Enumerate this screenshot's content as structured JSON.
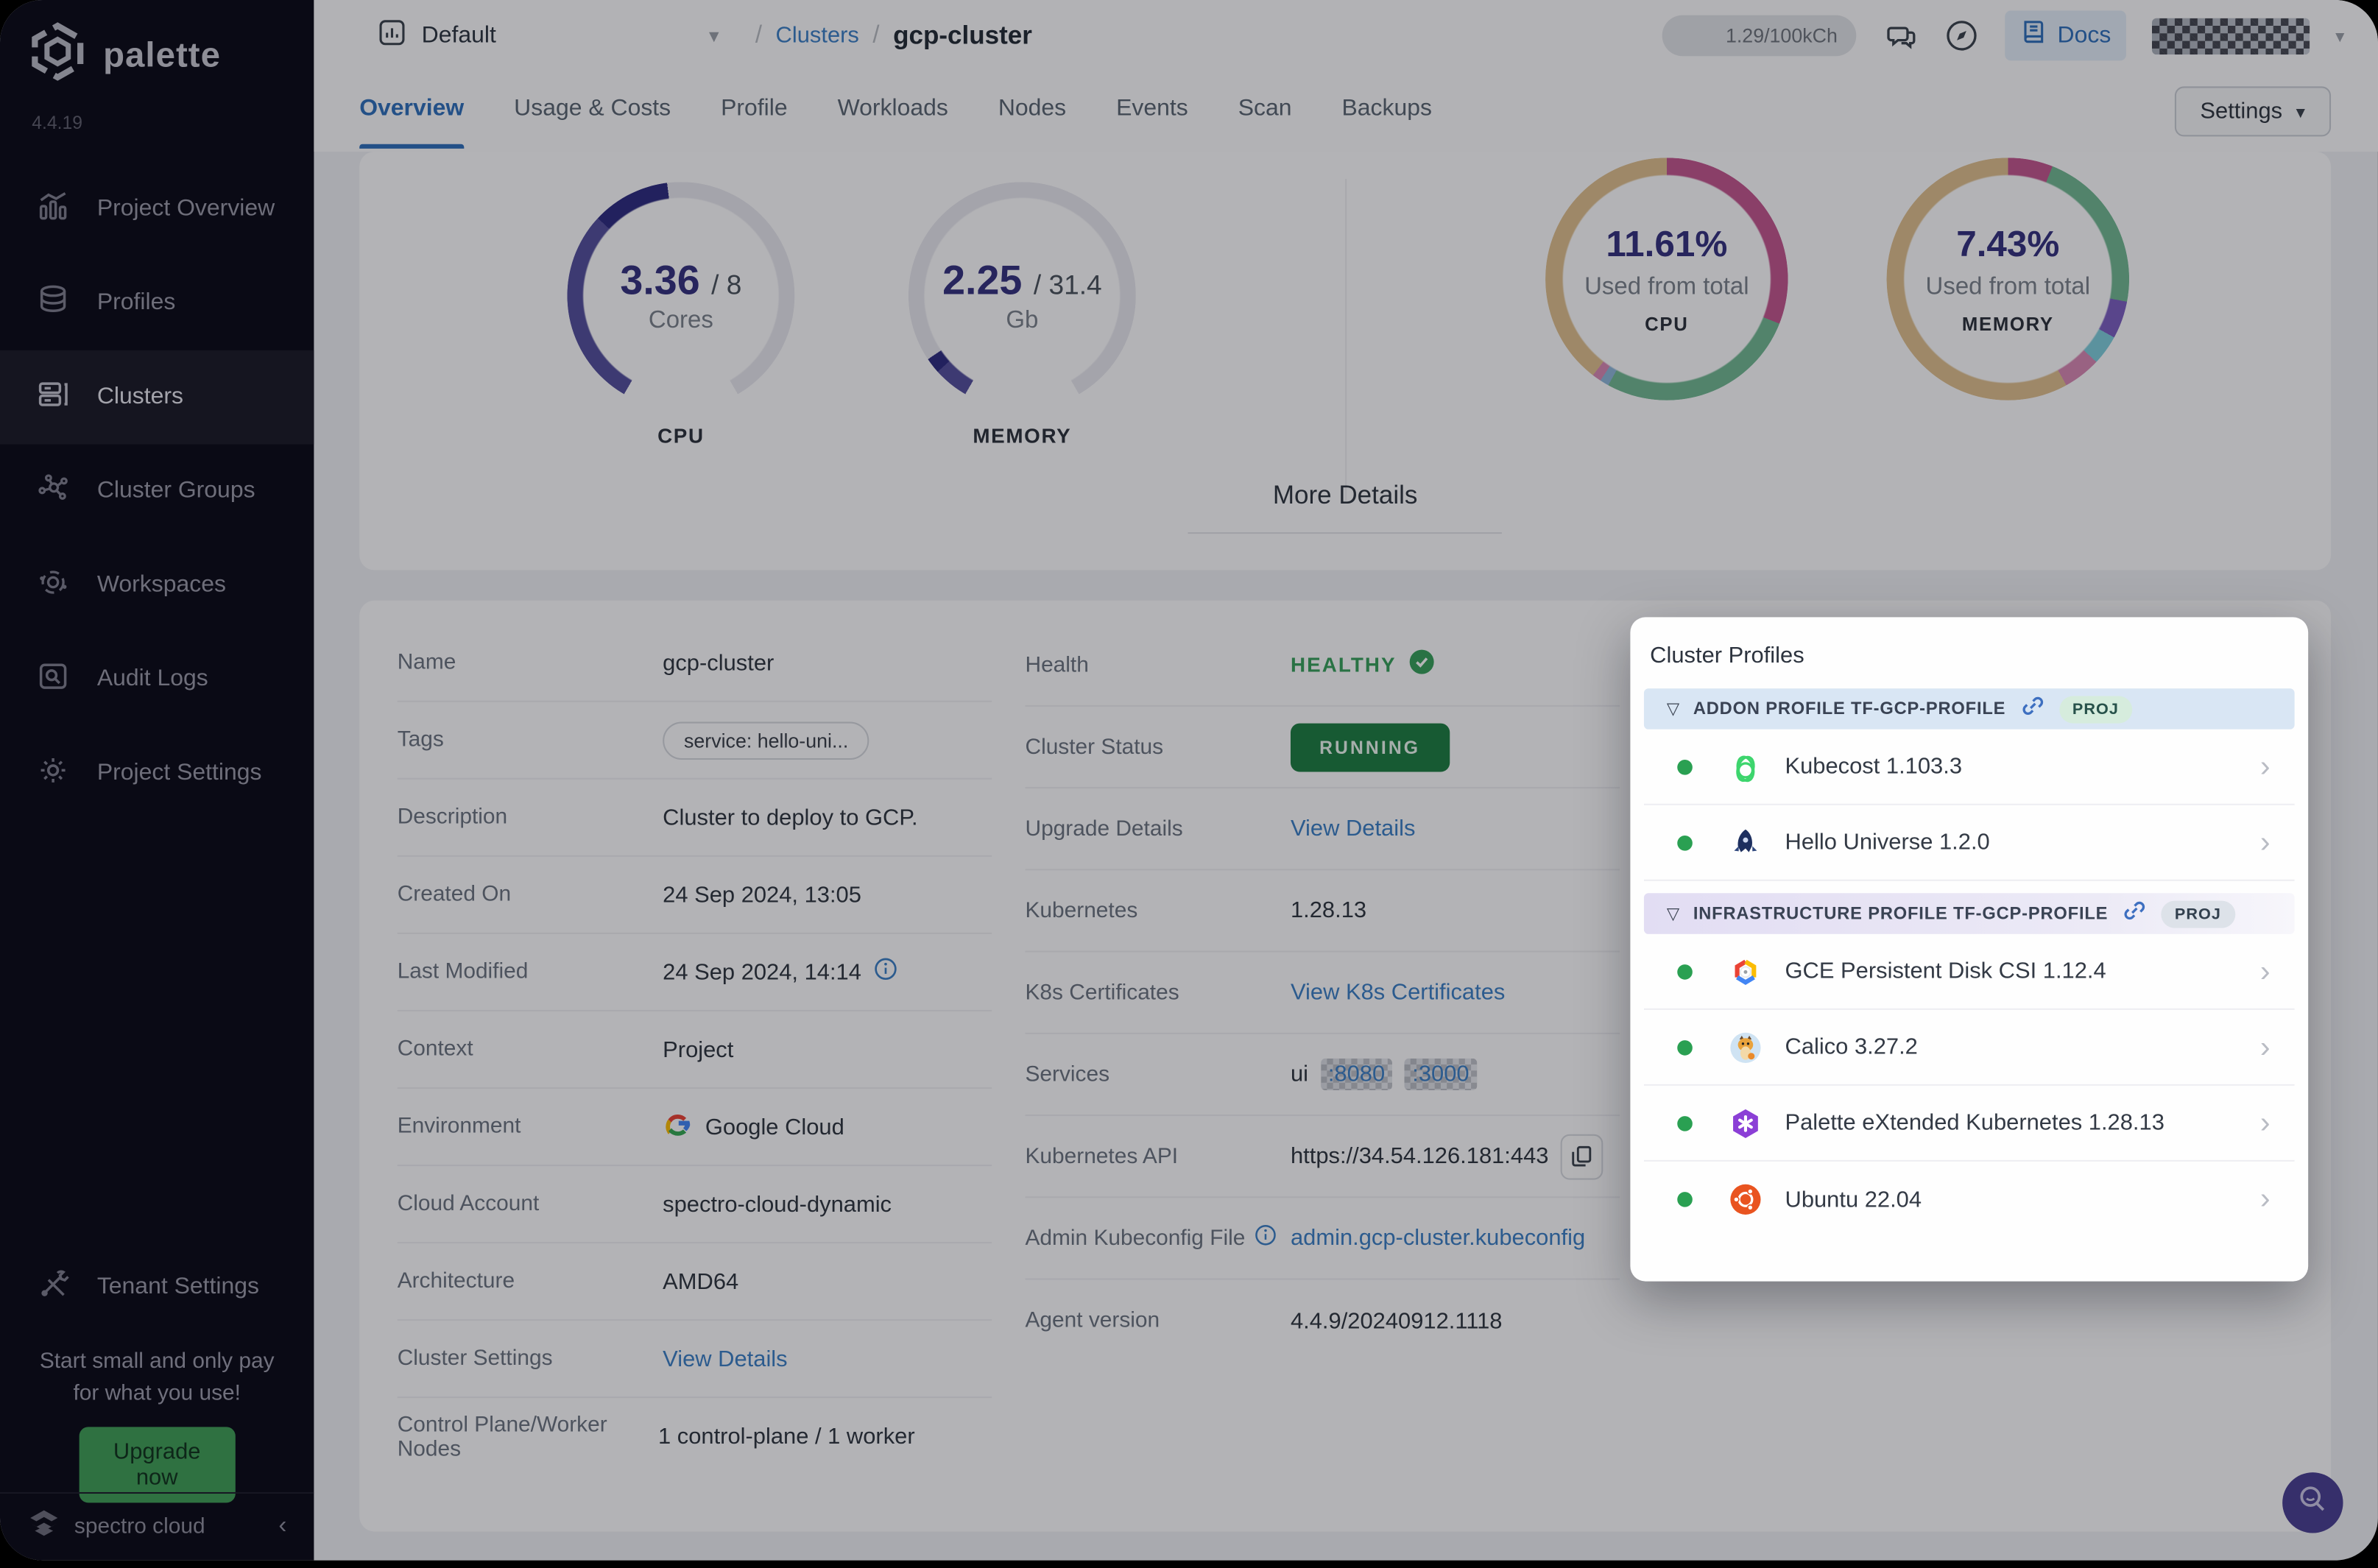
{
  "sidebar": {
    "logo_text": "palette",
    "version": "4.4.19",
    "items": [
      {
        "label": "Project Overview"
      },
      {
        "label": "Profiles"
      },
      {
        "label": "Clusters"
      },
      {
        "label": "Cluster Groups"
      },
      {
        "label": "Workspaces"
      },
      {
        "label": "Audit Logs"
      },
      {
        "label": "Project Settings"
      },
      {
        "label": "Tenant Settings"
      }
    ],
    "promo_line1": "Start small and only pay",
    "promo_line2": "for what you use!",
    "upgrade_label": "Upgrade now",
    "brand": "spectro cloud"
  },
  "topbar": {
    "project_selector": "Default",
    "breadcrumb_section": "Clusters",
    "breadcrumb_current": "gcp-cluster",
    "credits": "1.29/100kCh",
    "docs_label": "Docs"
  },
  "tabs": {
    "items": [
      "Overview",
      "Usage & Costs",
      "Profile",
      "Workloads",
      "Nodes",
      "Events",
      "Scan",
      "Backups"
    ],
    "settings_label": "Settings"
  },
  "stats": {
    "more_details_label": "More Details",
    "gauges": [
      {
        "metric": "CPU",
        "value": "3.36",
        "total": "/ 8",
        "unit": "Cores",
        "track_deg": 300,
        "segments": [
          {
            "color": "#54509c",
            "deg": 103
          },
          {
            "color": "#2d2b80",
            "deg": 40
          }
        ]
      },
      {
        "metric": "MEMORY",
        "value": "2.25",
        "total": "/ 31.4",
        "unit": "Gb",
        "track_deg": 300,
        "segments": [
          {
            "color": "#54509c",
            "deg": 18
          },
          {
            "color": "#2d2b80",
            "deg": 8
          }
        ]
      }
    ],
    "donuts": [
      {
        "metric": "CPU",
        "percent": "11.61%",
        "caption": "Used from total",
        "segments": [
          {
            "color": "#c2568f",
            "pct": 31
          },
          {
            "color": "#72b893",
            "pct": 27
          },
          {
            "color": "#8fb7d8",
            "pct": 1.2
          },
          {
            "color": "#d789b4",
            "pct": 1.2
          },
          {
            "color": "#debf8e",
            "pct": 39.6
          }
        ]
      },
      {
        "metric": "MEMORY",
        "percent": "7.43%",
        "caption": "Used from total",
        "segments": [
          {
            "color": "#c2568f",
            "pct": 6
          },
          {
            "color": "#72b893",
            "pct": 22
          },
          {
            "color": "#7b5fc1",
            "pct": 5
          },
          {
            "color": "#7fcddb",
            "pct": 4
          },
          {
            "color": "#d789b4",
            "pct": 5
          },
          {
            "color": "#debf8e",
            "pct": 58
          }
        ]
      }
    ]
  },
  "details": {
    "left": [
      {
        "label": "Name",
        "value": "gcp-cluster"
      },
      {
        "label": "Tags",
        "value": "service: hello-uni..."
      },
      {
        "label": "Description",
        "value": "Cluster to deploy to GCP."
      },
      {
        "label": "Created On",
        "value": "24 Sep 2024, 13:05"
      },
      {
        "label": "Last Modified",
        "value": "24 Sep 2024, 14:14"
      },
      {
        "label": "Context",
        "value": "Project"
      },
      {
        "label": "Environment",
        "value": "Google Cloud"
      },
      {
        "label": "Cloud Account",
        "value": "spectro-cloud-dynamic"
      },
      {
        "label": "Architecture",
        "value": "AMD64"
      },
      {
        "label": "Cluster Settings",
        "value": "View Details"
      },
      {
        "label": "Control Plane/Worker Nodes",
        "value": "1 control-plane / 1 worker"
      }
    ],
    "right": [
      {
        "label": "Health",
        "value": "HEALTHY"
      },
      {
        "label": "Cluster Status",
        "value": "RUNNING"
      },
      {
        "label": "Upgrade Details",
        "value": "View Details"
      },
      {
        "label": "Kubernetes",
        "value": "1.28.13"
      },
      {
        "label": "K8s Certificates",
        "value": "View K8s Certificates"
      },
      {
        "label": "Services",
        "value": "ui",
        "ports": [
          ":8080",
          ":3000"
        ]
      },
      {
        "label": "Kubernetes API",
        "value": "https://34.54.126.181:443"
      },
      {
        "label": "Admin Kubeconfig File",
        "value": "admin.gcp-cluster.kubeconfig"
      },
      {
        "label": "Agent version",
        "value": "4.4.9/20240912.1118"
      }
    ]
  },
  "profiles_panel": {
    "title": "Cluster Profiles",
    "sections": [
      {
        "title": "ADDON PROFILE TF-GCP-PROFILE",
        "badge": "PROJ",
        "items": [
          {
            "name": "Kubecost 1.103.3"
          },
          {
            "name": "Hello Universe 1.2.0"
          }
        ]
      },
      {
        "title": "INFRASTRUCTURE PROFILE TF-GCP-PROFILE",
        "badge": "PROJ",
        "items": [
          {
            "name": "GCE Persistent Disk CSI 1.12.4"
          },
          {
            "name": "Calico 3.27.2"
          },
          {
            "name": "Palette eXtended Kubernetes 1.28.13"
          },
          {
            "name": "Ubuntu 22.04"
          }
        ]
      }
    ]
  },
  "colors": {
    "accent_blue": "#2f6fba",
    "link_blue": "#3b7fc4",
    "healthy_green": "#37a05b",
    "running_green": "#1e7d42",
    "gauge_indigo": "#2d2b80",
    "sidebar_bg": "#0b0b18",
    "upgrade_green": "#3f9e57",
    "fab_purple": "#4a3f92"
  }
}
